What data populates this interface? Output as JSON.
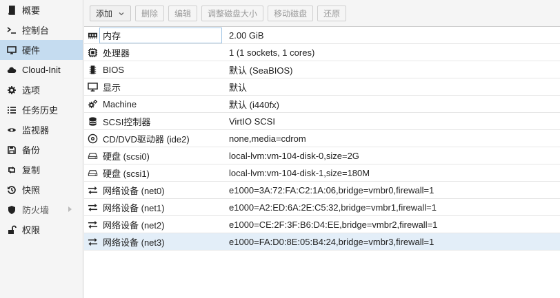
{
  "sidebar": {
    "items": [
      {
        "label": "概要",
        "icon": "book-icon",
        "active": false
      },
      {
        "label": "控制台",
        "icon": "terminal-icon",
        "active": false
      },
      {
        "label": "硬件",
        "icon": "monitor-icon",
        "active": true
      },
      {
        "label": "Cloud-Init",
        "icon": "cloud-icon",
        "active": false
      },
      {
        "label": "选项",
        "icon": "gear-icon",
        "active": false
      },
      {
        "label": "任务历史",
        "icon": "list-icon",
        "active": false
      },
      {
        "label": "监视器",
        "icon": "eye-icon",
        "active": false
      },
      {
        "label": "备份",
        "icon": "floppy-icon",
        "active": false
      },
      {
        "label": "复制",
        "icon": "retweet-icon",
        "active": false
      },
      {
        "label": "快照",
        "icon": "history-icon",
        "active": false
      },
      {
        "label": "防火墙",
        "icon": "shield-icon",
        "active": false,
        "expandable": true
      },
      {
        "label": "权限",
        "icon": "unlock-icon",
        "active": false
      }
    ]
  },
  "toolbar": {
    "add": "添加",
    "remove": "删除",
    "edit": "编辑",
    "resize": "调整磁盘大小",
    "move": "移动磁盘",
    "revert": "还原"
  },
  "hardware": [
    {
      "key": "内存",
      "value": "2.00 GiB",
      "icon": "memory-icon"
    },
    {
      "key": "处理器",
      "value": "1 (1 sockets, 1 cores)",
      "icon": "cpu-icon"
    },
    {
      "key": "BIOS",
      "value": "默认 (SeaBIOS)",
      "icon": "microchip-icon"
    },
    {
      "key": "显示",
      "value": "默认",
      "icon": "desktop-icon"
    },
    {
      "key": "Machine",
      "value": "默认 (i440fx)",
      "icon": "cogs-icon"
    },
    {
      "key": "SCSI控制器",
      "value": "VirtIO SCSI",
      "icon": "database-icon"
    },
    {
      "key": "CD/DVD驱动器 (ide2)",
      "value": "none,media=cdrom",
      "icon": "cdrom-icon"
    },
    {
      "key": "硬盘 (scsi0)",
      "value": "local-lvm:vm-104-disk-0,size=2G",
      "icon": "harddisk-icon"
    },
    {
      "key": "硬盘 (scsi1)",
      "value": "local-lvm:vm-104-disk-1,size=180M",
      "icon": "harddisk-icon"
    },
    {
      "key": "网络设备 (net0)",
      "value": "e1000=3A:72:FA:C2:1A:06,bridge=vmbr0,firewall=1",
      "icon": "exchange-icon"
    },
    {
      "key": "网络设备 (net1)",
      "value": "e1000=A2:ED:6A:2E:C5:32,bridge=vmbr1,firewall=1",
      "icon": "exchange-icon"
    },
    {
      "key": "网络设备 (net2)",
      "value": "e1000=CE:2F:3F:B6:D4:EE,bridge=vmbr2,firewall=1",
      "icon": "exchange-icon"
    },
    {
      "key": "网络设备 (net3)",
      "value": "e1000=FA:D0:8E:05:B4:24,bridge=vmbr3,firewall=1",
      "icon": "exchange-icon",
      "selected": true
    }
  ]
}
